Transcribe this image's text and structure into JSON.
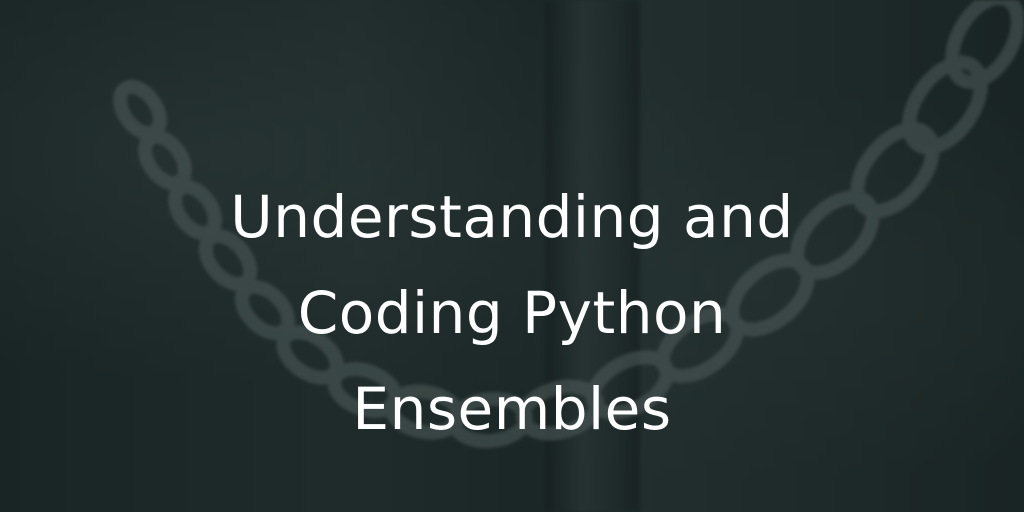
{
  "banner": {
    "title_lines": [
      "Understanding and",
      "Coding Python",
      "Ensembles"
    ]
  },
  "colors": {
    "background": "#1e2a2a",
    "text": "#ffffff"
  },
  "background_image": {
    "subject": "chain wrapped around a pole"
  }
}
